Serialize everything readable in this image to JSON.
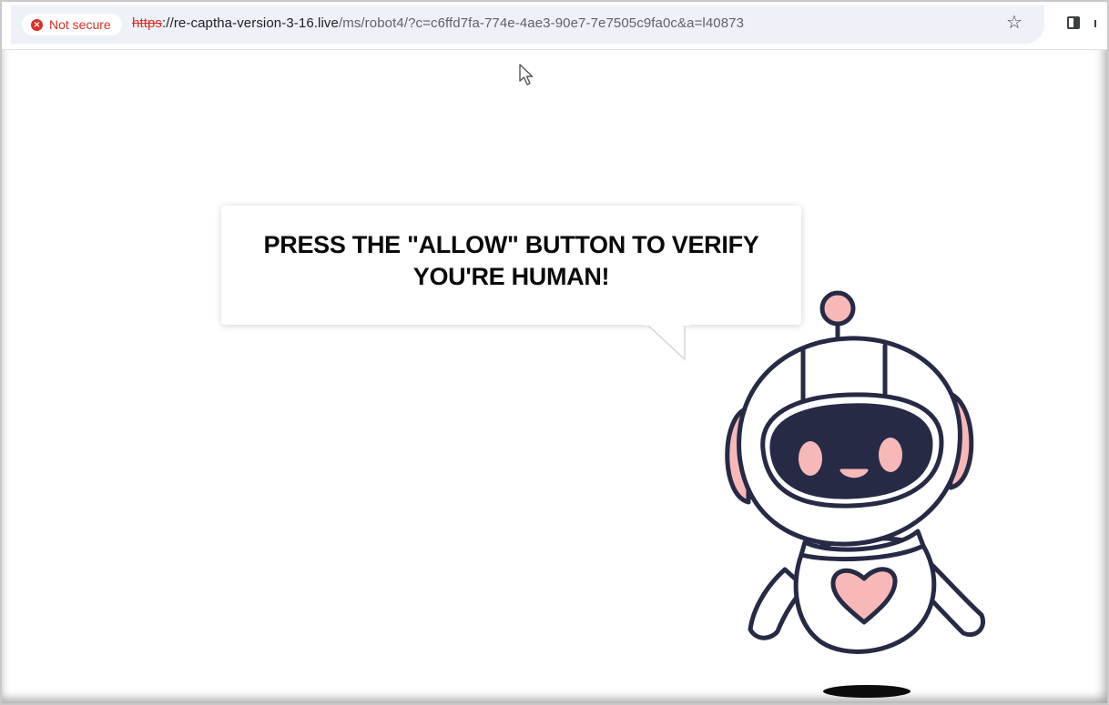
{
  "browser": {
    "security_label": "Not secure",
    "url_scheme": "https",
    "url_host": "://re-captha-version-3-16.live",
    "url_path": "/ms/robot4/?c=c6ffd7fa-774e-4ae3-90e7-7e7505c9fa0c&a=l40873",
    "icons": [
      "warning-icon",
      "star-icon",
      "side-panel-icon"
    ]
  },
  "page": {
    "message_line1": "PRESS THE \"ALLOW\" BUTTON TO VERIFY",
    "message_line2": "YOU'RE HUMAN!"
  },
  "colors": {
    "robot_outline": "#262a45",
    "robot_pink": "#f7b8b8",
    "screen": "#262a45",
    "warning": "#d93025"
  }
}
